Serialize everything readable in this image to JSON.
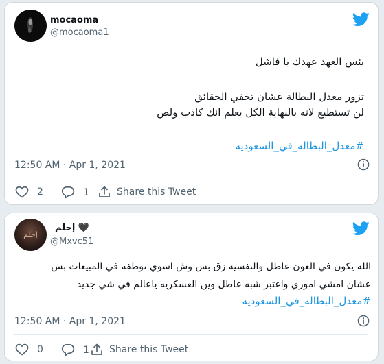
{
  "colors": {
    "background": "#e6ecf0",
    "card": "#ffffff",
    "text": "#0f1419",
    "secondary": "#536471",
    "hashtag": "#1b95e0",
    "twitter_blue": "#1da1f2"
  },
  "tweets": [
    {
      "display_name": "mocaoma",
      "handle": "@mocaoma1",
      "lines": [
        "بئس العهد عهدك يا فاشل",
        "تزور معدل البطالة عشان تخفي الحقائق",
        "لن تستطيع لانه بالنهاية الكل يعلم انك كاذب ولص"
      ],
      "hashtag": "#معدل_البطاله_في_السعوديه",
      "timestamp": "12:50 AM · Apr 1, 2021",
      "like_count": "2",
      "reply_count": "1",
      "share_label": "Share this Tweet",
      "icons": [
        "twitter-bird-icon",
        "info-icon",
        "heart-icon",
        "reply-icon",
        "share-icon"
      ]
    },
    {
      "display_name": "إحلم 🖤",
      "handle": "@Mxvc51",
      "avatar_text": "إحلم",
      "lines": [
        "الله يكون في العون عاطل والنفسيه زق بس وش اسوي توظفة في المبيعات بس",
        "عشان امشي اموري واعتبر شبه عاطل وين العسكريه ياعالم في شي جديد"
      ],
      "hashtag": "#معدل_البطاله_في_السعوديه",
      "timestamp": "12:50 AM · Apr 1, 2021",
      "like_count": "0",
      "reply_count": "1",
      "share_label": "Share this Tweet",
      "icons": [
        "twitter-bird-icon",
        "info-icon",
        "heart-icon",
        "reply-icon",
        "share-icon"
      ]
    }
  ]
}
